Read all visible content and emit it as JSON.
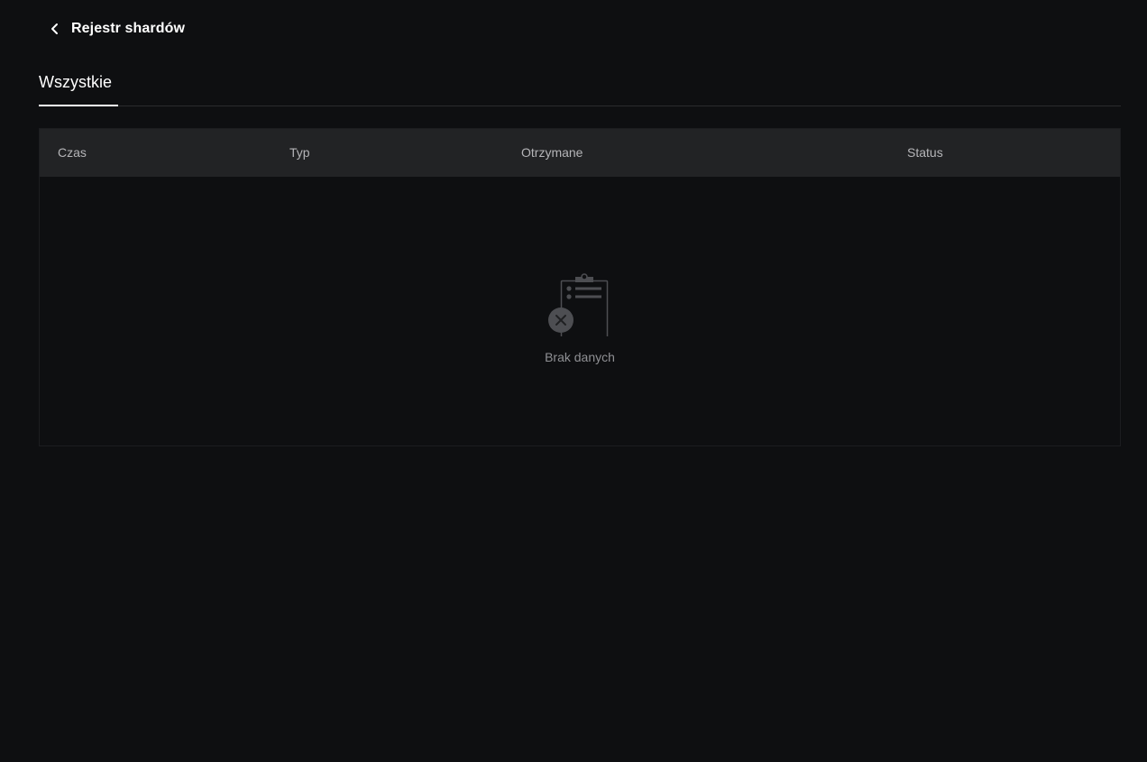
{
  "header": {
    "title": "Rejestr shardów",
    "back_icon": "chevron-left-icon"
  },
  "tabs": [
    {
      "label": "Wszystkie",
      "active": true
    }
  ],
  "table": {
    "columns": [
      "Czas",
      "Typ",
      "Otrzymane",
      "Status"
    ],
    "rows": [],
    "empty_text": "Brak danych",
    "empty_icon": "clipboard-empty-icon"
  },
  "colors": {
    "background": "#0e0f11",
    "header_row": "#222325",
    "text_primary": "#ffffff",
    "text_muted": "#8f9094"
  }
}
